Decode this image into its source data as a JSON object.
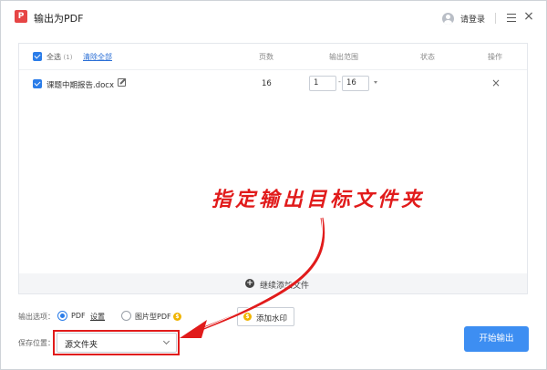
{
  "app": {
    "title": "输出为PDF",
    "logo_text": "P"
  },
  "titlebar": {
    "login_label": "请登录",
    "close_glyph": "×"
  },
  "table": {
    "select_all_label": "全选",
    "count_label": "(1)",
    "clear_all_label": "清除全部",
    "columns": {
      "pages": "页数",
      "range": "输出范围",
      "status": "状态",
      "action": "操作"
    }
  },
  "rows": [
    {
      "filename": "课题中期报告.docx",
      "pages": "16",
      "range_from": "1",
      "range_to": "16",
      "range_dash": "-",
      "delete_glyph": "×"
    }
  ],
  "add_files": {
    "icon": "+",
    "label": "继续添加文件"
  },
  "options": {
    "label": "输出选项：",
    "pdf_label": "PDF",
    "settings_label": "设置",
    "image_pdf_label": "图片型PDF",
    "coin_glyph": "$",
    "watermark_label": "添加水印"
  },
  "save": {
    "label": "保存位置：",
    "value": "源文件夹"
  },
  "start_button": "开始输出",
  "annotation": {
    "text": "指定输出目标文件夹",
    "color": "#e11b1b"
  },
  "colors": {
    "accent": "#2b7de9",
    "primary_button": "#3d8ef2",
    "annotation_red": "#e11b1b"
  }
}
